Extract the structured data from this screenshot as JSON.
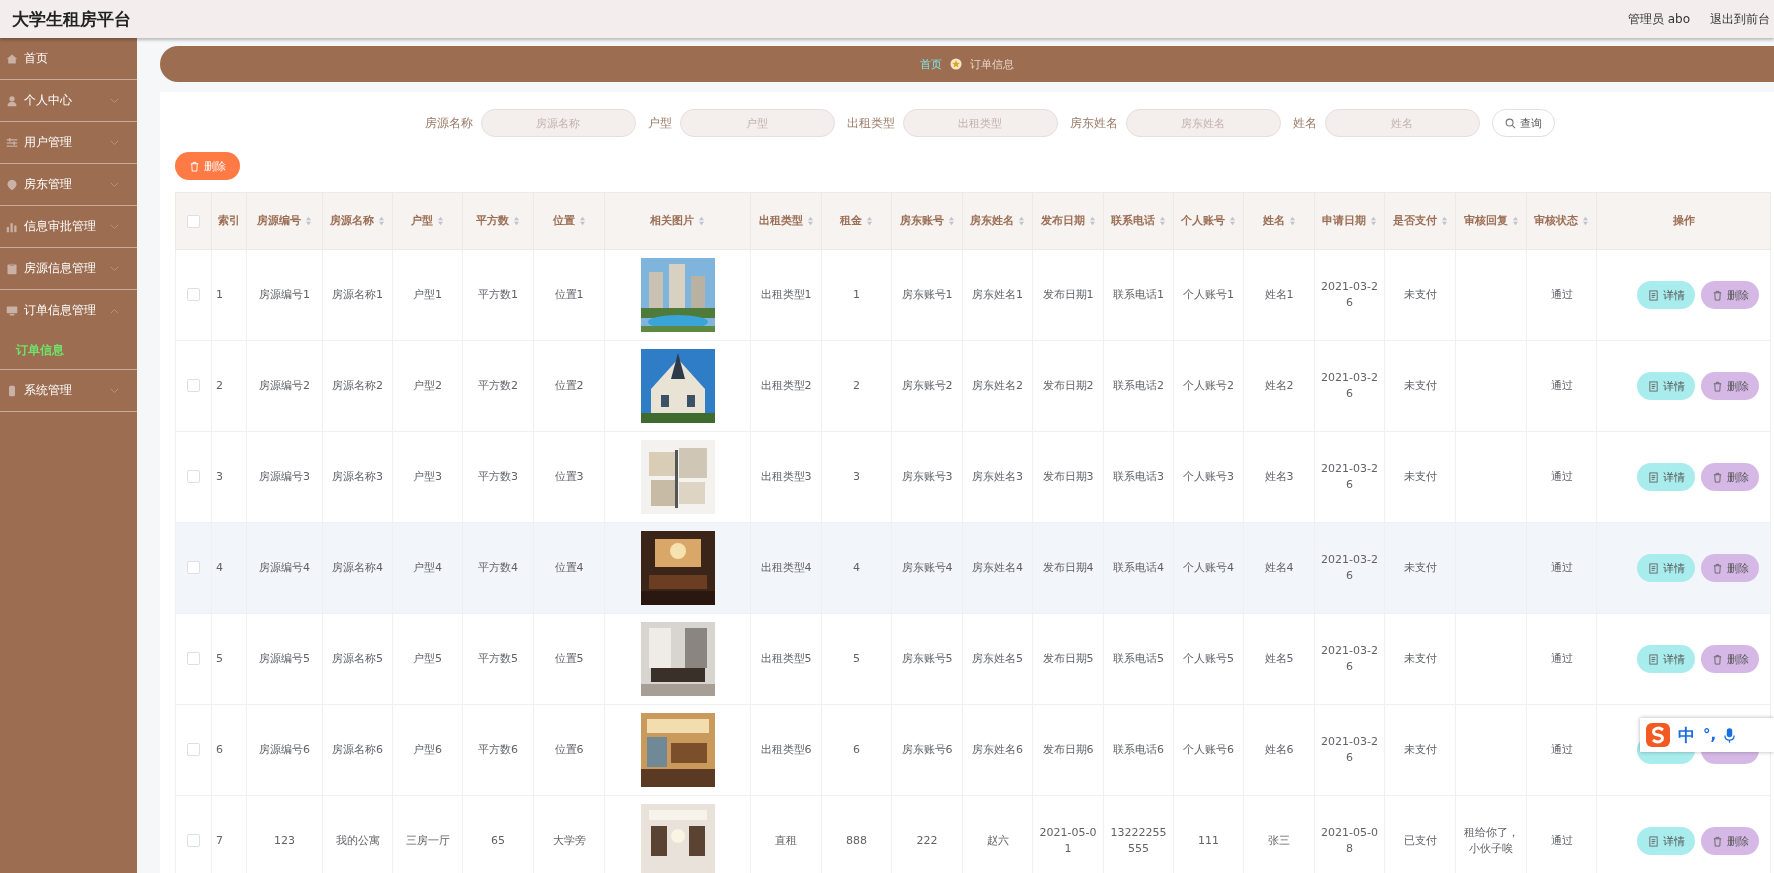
{
  "header": {
    "title": "大学生租房平台",
    "user": "管理员 abo",
    "exit": "退出到前台"
  },
  "sidebar": {
    "items": [
      {
        "label": "首页",
        "kind": "link"
      },
      {
        "label": "个人中心",
        "kind": "menu",
        "expanded": false
      },
      {
        "label": "用户管理",
        "kind": "menu",
        "expanded": false
      },
      {
        "label": "房东管理",
        "kind": "menu",
        "expanded": false
      },
      {
        "label": "信息审批管理",
        "kind": "menu",
        "expanded": false
      },
      {
        "label": "房源信息管理",
        "kind": "menu",
        "expanded": false
      },
      {
        "label": "订单信息管理",
        "kind": "menu",
        "expanded": true,
        "children": [
          {
            "label": "订单信息",
            "selected": true
          }
        ]
      },
      {
        "label": "系统管理",
        "kind": "menu",
        "expanded": false
      }
    ]
  },
  "breadcrumb": [
    "首页",
    "订单信息"
  ],
  "search": {
    "fields": [
      {
        "label": "房源名称",
        "placeholder": "房源名称"
      },
      {
        "label": "户型",
        "placeholder": "户型"
      },
      {
        "label": "出租类型",
        "placeholder": "出租类型"
      },
      {
        "label": "房东姓名",
        "placeholder": "房东姓名"
      },
      {
        "label": "姓名",
        "placeholder": "姓名"
      }
    ],
    "button": "查询"
  },
  "bulk_delete": "删除",
  "table": {
    "all_selected": false,
    "columns": [
      {
        "kind": "check"
      },
      {
        "label": "索引",
        "kind": "text",
        "sortable": false
      },
      {
        "label": "房源编号",
        "kind": "text",
        "sortable": true
      },
      {
        "label": "房源名称",
        "kind": "text",
        "sortable": true
      },
      {
        "label": "户型",
        "kind": "text",
        "sortable": true
      },
      {
        "label": "平方数",
        "kind": "text",
        "sortable": true
      },
      {
        "label": "位置",
        "kind": "text",
        "sortable": true
      },
      {
        "label": "相关图片",
        "kind": "picture",
        "sortable": true
      },
      {
        "label": "出租类型",
        "kind": "text",
        "sortable": true
      },
      {
        "label": "租金",
        "kind": "text",
        "sortable": true
      },
      {
        "label": "房东账号",
        "kind": "text",
        "sortable": true
      },
      {
        "label": "房东姓名",
        "kind": "text",
        "sortable": true
      },
      {
        "label": "发布日期",
        "kind": "text",
        "sortable": true
      },
      {
        "label": "联系电话",
        "kind": "text",
        "sortable": true
      },
      {
        "label": "个人账号",
        "kind": "text",
        "sortable": true
      },
      {
        "label": "姓名",
        "kind": "text",
        "sortable": true
      },
      {
        "label": "申请日期",
        "kind": "text",
        "sortable": true
      },
      {
        "label": "是否支付",
        "kind": "text",
        "sortable": true
      },
      {
        "label": "审核回复",
        "kind": "text",
        "sortable": true
      },
      {
        "label": "审核状态",
        "kind": "text",
        "sortable": true
      },
      {
        "label": "操作",
        "kind": "actions",
        "sortable": false
      }
    ],
    "rows": [
      {
        "selected": false,
        "hovered": false,
        "cells": [
          "",
          "1",
          "房源编号1",
          "房源名称1",
          "户型1",
          "平方数1",
          "位置1",
          "",
          "出租类型1",
          "1",
          "房东账号1",
          "房东姓名1",
          "发布日期1",
          "联系电话1",
          "个人账号1",
          "姓名1",
          "2021-03-26",
          "未支付",
          "",
          "通过"
        ],
        "actions": [
          {
            "kind": "detail",
            "label": "详情"
          },
          {
            "kind": "delete",
            "label": "删除"
          }
        ]
      },
      {
        "selected": false,
        "hovered": false,
        "cells": [
          "",
          "2",
          "房源编号2",
          "房源名称2",
          "户型2",
          "平方数2",
          "位置2",
          "",
          "出租类型2",
          "2",
          "房东账号2",
          "房东姓名2",
          "发布日期2",
          "联系电话2",
          "个人账号2",
          "姓名2",
          "2021-03-26",
          "未支付",
          "",
          "通过"
        ],
        "actions": [
          {
            "kind": "detail",
            "label": "详情"
          },
          {
            "kind": "delete",
            "label": "删除"
          }
        ]
      },
      {
        "selected": false,
        "hovered": false,
        "cells": [
          "",
          "3",
          "房源编号3",
          "房源名称3",
          "户型3",
          "平方数3",
          "位置3",
          "",
          "出租类型3",
          "3",
          "房东账号3",
          "房东姓名3",
          "发布日期3",
          "联系电话3",
          "个人账号3",
          "姓名3",
          "2021-03-26",
          "未支付",
          "",
          "通过"
        ],
        "actions": [
          {
            "kind": "detail",
            "label": "详情"
          },
          {
            "kind": "delete",
            "label": "删除"
          }
        ]
      },
      {
        "selected": false,
        "hovered": true,
        "cells": [
          "",
          "4",
          "房源编号4",
          "房源名称4",
          "户型4",
          "平方数4",
          "位置4",
          "",
          "出租类型4",
          "4",
          "房东账号4",
          "房东姓名4",
          "发布日期4",
          "联系电话4",
          "个人账号4",
          "姓名4",
          "2021-03-26",
          "未支付",
          "",
          "通过"
        ],
        "actions": [
          {
            "kind": "detail",
            "label": "详情"
          },
          {
            "kind": "delete",
            "label": "删除"
          }
        ]
      },
      {
        "selected": false,
        "hovered": false,
        "cells": [
          "",
          "5",
          "房源编号5",
          "房源名称5",
          "户型5",
          "平方数5",
          "位置5",
          "",
          "出租类型5",
          "5",
          "房东账号5",
          "房东姓名5",
          "发布日期5",
          "联系电话5",
          "个人账号5",
          "姓名5",
          "2021-03-26",
          "未支付",
          "",
          "通过"
        ],
        "actions": [
          {
            "kind": "detail",
            "label": "详情"
          },
          {
            "kind": "delete",
            "label": "删除"
          }
        ]
      },
      {
        "selected": false,
        "hovered": false,
        "cells": [
          "",
          "6",
          "房源编号6",
          "房源名称6",
          "户型6",
          "平方数6",
          "位置6",
          "",
          "出租类型6",
          "6",
          "房东账号6",
          "房东姓名6",
          "发布日期6",
          "联系电话6",
          "个人账号6",
          "姓名6",
          "2021-03-26",
          "未支付",
          "",
          "通过"
        ],
        "actions": [
          {
            "kind": "detail"
          },
          {
            "kind": "delete"
          }
        ]
      },
      {
        "selected": false,
        "hovered": false,
        "cells": [
          "",
          "7",
          "123",
          "我的公寓",
          "三房一厅",
          "65",
          "大学旁",
          "",
          "直租",
          "888",
          "222",
          "赵六",
          "2021-05-01",
          "13222255555",
          "111",
          "张三",
          "2021-05-08",
          "已支付",
          "租给你了，小伙子唉",
          "通过"
        ],
        "actions": [
          {
            "kind": "detail",
            "label": "详情"
          },
          {
            "kind": "delete",
            "label": "删除"
          }
        ]
      }
    ]
  },
  "ime_bar": {
    "mode": "中",
    "punctuation": "°,"
  }
}
